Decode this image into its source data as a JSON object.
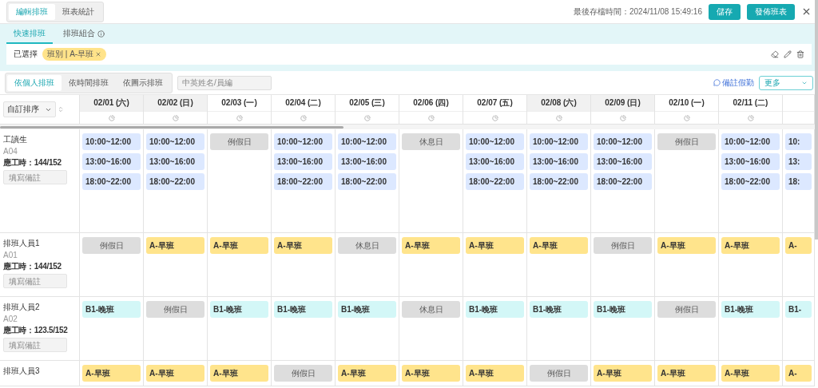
{
  "top_bar": {
    "tabs": [
      {
        "label": "編輯排班",
        "selected": true
      },
      {
        "label": "班表統計",
        "selected": false
      }
    ],
    "last_saved": "最後存檔時間：2024/11/08 15:49:16",
    "buttons": [
      "儲存",
      "發佈班表"
    ]
  },
  "panel": {
    "tabs": [
      {
        "label": "快速排班",
        "selected": true,
        "info": false
      },
      {
        "label": "排班組合",
        "selected": false,
        "info": true
      }
    ],
    "selected_label": "已選擇",
    "chips": [
      "班別 | A-早班"
    ]
  },
  "toolbar": {
    "view_tabs": [
      {
        "label": "依個人排班",
        "selected": true
      },
      {
        "label": "依時間排班",
        "selected": false
      },
      {
        "label": "依圖示排班",
        "selected": false
      }
    ],
    "search": {
      "placeholder": "中英姓名/員編"
    },
    "note_link": "備註假勤",
    "more_select": "更多"
  },
  "schedule": {
    "sort_select": "自訂排序",
    "days": [
      {
        "label": "02/01 (六)",
        "weekend": true
      },
      {
        "label": "02/02 (日)",
        "weekend": true
      },
      {
        "label": "02/03 (一)",
        "weekend": false
      },
      {
        "label": "02/04 (二)",
        "weekend": false
      },
      {
        "label": "02/05 (三)",
        "weekend": false
      },
      {
        "label": "02/06 (四)",
        "weekend": false
      },
      {
        "label": "02/07 (五)",
        "weekend": false
      },
      {
        "label": "02/08 (六)",
        "weekend": true
      },
      {
        "label": "02/09 (日)",
        "weekend": true
      },
      {
        "label": "02/10 (一)",
        "weekend": false
      },
      {
        "label": "02/11 (二)",
        "weekend": false
      }
    ],
    "employees": [
      {
        "name": "工讀生",
        "id": "A04",
        "hours": "應工時：144/152",
        "note_placeholder": "填寫備註",
        "cells": [
          {
            "kind": "times",
            "times": [
              "10:00~12:00",
              "13:00~16:00",
              "18:00~22:00"
            ]
          },
          {
            "kind": "times",
            "times": [
              "10:00~12:00",
              "13:00~16:00",
              "18:00~22:00"
            ]
          },
          {
            "kind": "off",
            "label": "例假日"
          },
          {
            "kind": "times",
            "times": [
              "10:00~12:00",
              "13:00~16:00",
              "18:00~22:00"
            ]
          },
          {
            "kind": "times",
            "times": [
              "10:00~12:00",
              "13:00~16:00",
              "18:00~22:00"
            ]
          },
          {
            "kind": "off",
            "label": "休息日"
          },
          {
            "kind": "times",
            "times": [
              "10:00~12:00",
              "13:00~16:00",
              "18:00~22:00"
            ]
          },
          {
            "kind": "times",
            "times": [
              "10:00~12:00",
              "13:00~16:00",
              "18:00~22:00"
            ]
          },
          {
            "kind": "times",
            "times": [
              "10:00~12:00",
              "13:00~16:00",
              "18:00~22:00"
            ]
          },
          {
            "kind": "off",
            "label": "例假日"
          },
          {
            "kind": "times",
            "times": [
              "10:00~12:00",
              "13:00~16:00",
              "18:00~22:00"
            ]
          },
          {
            "kind": "times",
            "times": [
              "10:",
              "13:",
              "18:"
            ]
          }
        ]
      },
      {
        "name": "排班人員1",
        "id": "A01",
        "hours": "應工時：144/152",
        "note_placeholder": "填寫備註",
        "cells": [
          {
            "kind": "off",
            "label": "例假日"
          },
          {
            "kind": "early",
            "label": "A-早班"
          },
          {
            "kind": "early",
            "label": "A-早班"
          },
          {
            "kind": "early",
            "label": "A-早班"
          },
          {
            "kind": "off",
            "label": "休息日"
          },
          {
            "kind": "early",
            "label": "A-早班"
          },
          {
            "kind": "early",
            "label": "A-早班"
          },
          {
            "kind": "early",
            "label": "A-早班"
          },
          {
            "kind": "off",
            "label": "例假日"
          },
          {
            "kind": "early",
            "label": "A-早班"
          },
          {
            "kind": "early",
            "label": "A-早班"
          },
          {
            "kind": "early",
            "label": "A-"
          }
        ]
      },
      {
        "name": "排班人員2",
        "id": "A02",
        "hours": "應工時：123.5/152",
        "note_placeholder": "填寫備註",
        "cells": [
          {
            "kind": "late",
            "label": "B1-晚班"
          },
          {
            "kind": "off",
            "label": "例假日"
          },
          {
            "kind": "late",
            "label": "B1-晚班"
          },
          {
            "kind": "late",
            "label": "B1-晚班"
          },
          {
            "kind": "late",
            "label": "B1-晚班"
          },
          {
            "kind": "off",
            "label": "休息日"
          },
          {
            "kind": "late",
            "label": "B1-晚班"
          },
          {
            "kind": "late",
            "label": "B1-晚班"
          },
          {
            "kind": "late",
            "label": "B1-晚班"
          },
          {
            "kind": "off",
            "label": "例假日"
          },
          {
            "kind": "late",
            "label": "B1-晚班"
          },
          {
            "kind": "late",
            "label": "B1-"
          }
        ]
      },
      {
        "name": "排班人員3",
        "cells": [
          {
            "kind": "early",
            "label": "A-早班"
          },
          {
            "kind": "early",
            "label": "A-早班"
          },
          {
            "kind": "early",
            "label": "A-早班"
          },
          {
            "kind": "off",
            "label": "例假日"
          },
          {
            "kind": "early",
            "label": "A-早班"
          },
          {
            "kind": "early",
            "label": "A-早班"
          },
          {
            "kind": "early",
            "label": "A-早班"
          },
          {
            "kind": "off",
            "label": "例假日"
          },
          {
            "kind": "early",
            "label": "A-早班"
          },
          {
            "kind": "early",
            "label": "A-早班"
          },
          {
            "kind": "early",
            "label": "A-早班"
          },
          {
            "kind": "early",
            "label": "A-"
          }
        ]
      }
    ]
  }
}
